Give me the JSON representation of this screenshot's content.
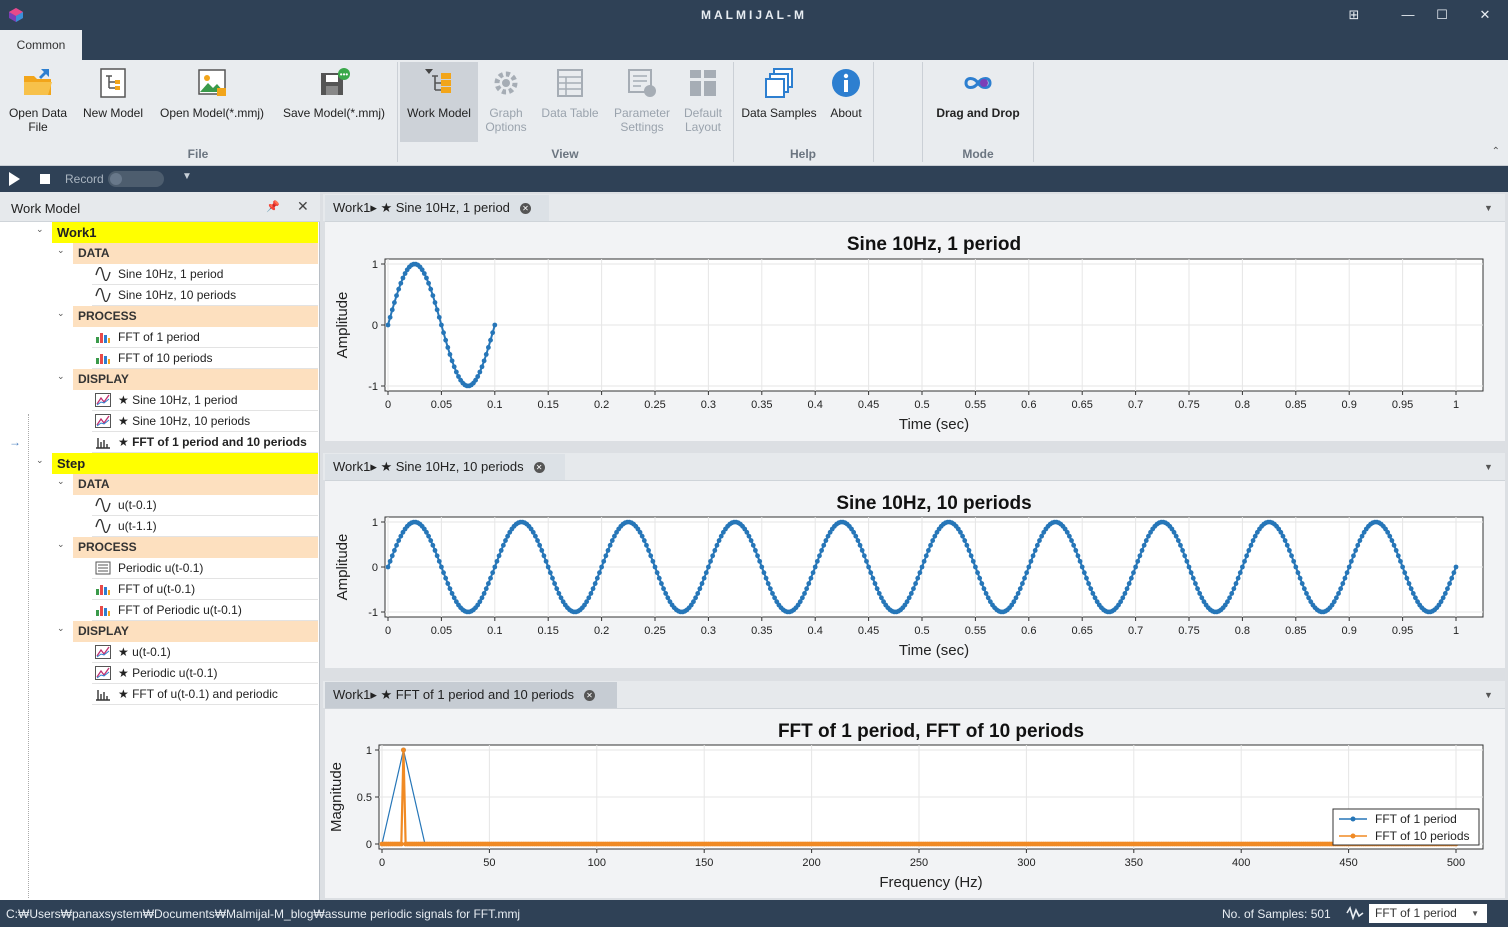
{
  "app": {
    "title": "MALMIJAL-M",
    "window_buttons": [
      "restore-layout",
      "minimize",
      "maximize",
      "close"
    ]
  },
  "ribbon": {
    "tab": "Common",
    "groups": [
      {
        "label": "File",
        "buttons": [
          {
            "label": "Open Data\nFile",
            "icon": "open-folder-icon"
          },
          {
            "label": "New Model",
            "icon": "new-model-icon"
          },
          {
            "label": "Open Model(*.mmj)",
            "icon": "open-model-icon"
          },
          {
            "label": "Save Model(*.mmj)",
            "icon": "save-model-icon"
          }
        ]
      },
      {
        "label": "View",
        "buttons": [
          {
            "label": "Work Model",
            "icon": "work-model-icon",
            "active": true
          },
          {
            "label": "Graph\nOptions",
            "icon": "gear-icon",
            "disabled": true
          },
          {
            "label": "Data Table",
            "icon": "table-icon",
            "disabled": true
          },
          {
            "label": "Parameter\nSettings",
            "icon": "parameter-settings-icon",
            "disabled": true
          },
          {
            "label": "Default\nLayout",
            "icon": "layout-icon",
            "disabled": true
          }
        ]
      },
      {
        "label": "Help",
        "buttons": [
          {
            "label": "Data Samples",
            "icon": "data-samples-icon"
          },
          {
            "label": "About",
            "icon": "info-icon"
          }
        ]
      },
      {
        "label": "Mode",
        "buttons": [
          {
            "label": "Drag and Drop",
            "icon": "infinity-icon"
          }
        ]
      }
    ]
  },
  "record_bar": {
    "record_label": "Record"
  },
  "work_model": {
    "title": "Work Model",
    "groups": [
      {
        "name": "Work1",
        "categories": [
          {
            "name": "DATA",
            "items": [
              {
                "label": "Sine 10Hz, 1 period",
                "icon": "sine-wave-icon"
              },
              {
                "label": "Sine 10Hz, 10 periods",
                "icon": "sine-wave-icon"
              }
            ]
          },
          {
            "name": "PROCESS",
            "items": [
              {
                "label": "FFT of 1 period",
                "icon": "fft-process-icon"
              },
              {
                "label": "FFT of 10 periods",
                "icon": "fft-process-icon"
              }
            ]
          },
          {
            "name": "DISPLAY",
            "items": [
              {
                "label": "★ Sine 10Hz, 1 period",
                "icon": "line-display-icon"
              },
              {
                "label": "★ Sine 10Hz, 10 periods",
                "icon": "line-display-icon"
              },
              {
                "label": "★ FFT of 1 period and 10 periods",
                "icon": "stem-display-icon",
                "selected": true
              }
            ]
          }
        ]
      },
      {
        "name": "Step",
        "categories": [
          {
            "name": "DATA",
            "items": [
              {
                "label": "u(t-0.1)",
                "icon": "sine-wave-icon"
              },
              {
                "label": "u(t-1.1)",
                "icon": "sine-wave-icon"
              }
            ]
          },
          {
            "name": "PROCESS",
            "items": [
              {
                "label": "Periodic u(t-0.1)",
                "icon": "periodic-process-icon"
              },
              {
                "label": "FFT of u(t-0.1)",
                "icon": "fft-process-icon"
              },
              {
                "label": "FFT of Periodic u(t-0.1)",
                "icon": "fft-process-icon"
              }
            ]
          },
          {
            "name": "DISPLAY",
            "items": [
              {
                "label": "★ u(t-0.1)",
                "icon": "line-display-icon"
              },
              {
                "label": "★ Periodic u(t-0.1)",
                "icon": "line-display-icon"
              },
              {
                "label": "★ FFT of u(t-0.1) and periodic",
                "icon": "stem-display-icon"
              }
            ]
          }
        ]
      }
    ]
  },
  "panes": [
    {
      "tab": "Work1▸ ★ Sine 10Hz, 1 period"
    },
    {
      "tab": "Work1▸ ★ Sine 10Hz, 10 periods"
    },
    {
      "tab": "Work1▸ ★ FFT of 1 period and 10 periods",
      "active": true
    }
  ],
  "chart_data": [
    {
      "type": "scatter",
      "title": "Sine 10Hz, 1 period",
      "xlabel": "Time (sec)",
      "ylabel": "Amplitude",
      "xlim": [
        0,
        1
      ],
      "ylim": [
        -1,
        1
      ],
      "xticks": [
        "0",
        "0.05",
        "0.1",
        "0.15",
        "0.2",
        "0.25",
        "0.3",
        "0.35",
        "0.4",
        "0.45",
        "0.5",
        "0.55",
        "0.6",
        "0.65",
        "0.7",
        "0.75",
        "0.8",
        "0.85",
        "0.9",
        "0.95",
        "1"
      ],
      "yticks": [
        "-1",
        "0",
        "1"
      ],
      "grid": true,
      "series": [
        {
          "function": "sin(2*pi*10*t)",
          "x_start": 0,
          "x_end": 0.1,
          "samples": 51,
          "color": "#2676b8"
        }
      ]
    },
    {
      "type": "scatter",
      "title": "Sine 10Hz, 10 periods",
      "xlabel": "Time (sec)",
      "ylabel": "Amplitude",
      "xlim": [
        0,
        1
      ],
      "ylim": [
        -1,
        1
      ],
      "xticks": [
        "0",
        "0.05",
        "0.1",
        "0.15",
        "0.2",
        "0.25",
        "0.3",
        "0.35",
        "0.4",
        "0.45",
        "0.5",
        "0.55",
        "0.6",
        "0.65",
        "0.7",
        "0.75",
        "0.8",
        "0.85",
        "0.9",
        "0.95",
        "1"
      ],
      "yticks": [
        "-1",
        "0",
        "1"
      ],
      "grid": true,
      "series": [
        {
          "function": "sin(2*pi*10*t)",
          "x_start": 0,
          "x_end": 1,
          "samples": 501,
          "color": "#2676b8"
        }
      ]
    },
    {
      "type": "line",
      "title": "FFT of 1 period, FFT of 10 periods",
      "xlabel": "Frequency (Hz)",
      "ylabel": "Magnitude",
      "xlim": [
        0,
        500
      ],
      "ylim": [
        0,
        1
      ],
      "xticks": [
        "0",
        "50",
        "100",
        "150",
        "200",
        "250",
        "300",
        "350",
        "400",
        "450",
        "500"
      ],
      "yticks": [
        "0",
        "0.5",
        "1"
      ],
      "grid": true,
      "legend": "bottom-right",
      "series": [
        {
          "name": "FFT of 1 period",
          "color": "#2676b8",
          "x": [
            0,
            10,
            20,
            30,
            500
          ],
          "y": [
            0,
            1,
            0,
            0,
            0
          ]
        },
        {
          "name": "FFT of 10 periods",
          "color": "#f08a24",
          "x": [
            0,
            9,
            10,
            11,
            12,
            500
          ],
          "y": [
            0,
            0,
            1,
            0,
            0,
            0
          ],
          "marker_step": 1
        }
      ]
    }
  ],
  "status_bar": {
    "path": "C:₩Users₩panaxsystem₩Documents₩Malmijal-M_blog₩assume periodic signals for FFT.mmj",
    "samples": "No. of Samples: 501",
    "selector_value": "FFT of 1 period"
  }
}
